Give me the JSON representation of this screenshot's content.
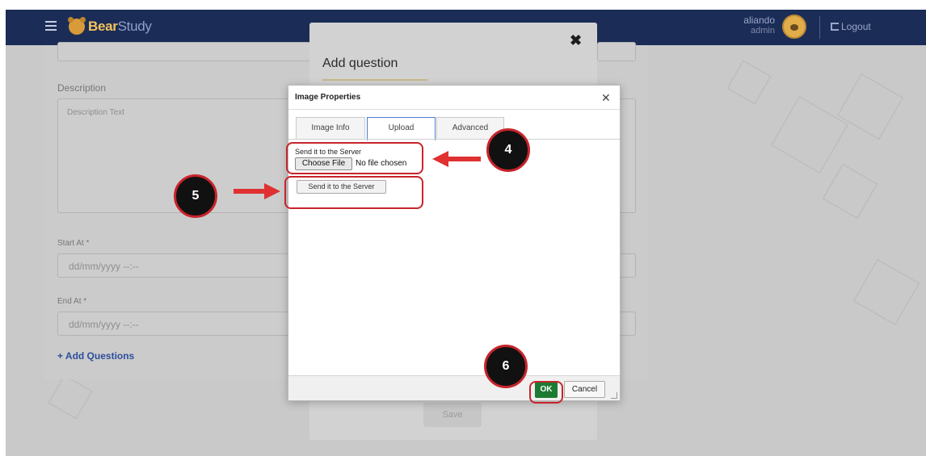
{
  "navbar": {
    "brand_part1": "Bear",
    "brand_part2": "Study",
    "user_name": "aliando",
    "user_role": "admin",
    "logout_label": "Logout"
  },
  "background_form": {
    "description_label": "Description",
    "description_placeholder": "Description Text",
    "start_label": "Start At *",
    "start_placeholder": "dd/mm/yyyy --:--",
    "end_label": "End At *",
    "end_placeholder": "dd/mm/yyyy --:--",
    "add_questions_label": "+ Add Questions"
  },
  "add_question_modal": {
    "title": "Add question",
    "close_glyph": "✖",
    "save_label": "Save"
  },
  "image_dialog": {
    "title": "Image Properties",
    "close_glyph": "✕",
    "tabs": [
      {
        "label": "Image Info"
      },
      {
        "label": "Upload"
      },
      {
        "label": "Advanced"
      }
    ],
    "active_tab": "Upload",
    "upload_label": "Send it to the Server",
    "choose_file_label": "Choose File",
    "no_file_text": "No file chosen",
    "send_button_label": "Send it to the Server",
    "ok_label": "OK",
    "cancel_label": "Cancel"
  },
  "annotations": {
    "badge_4": "4",
    "badge_5": "5",
    "badge_6": "6",
    "highlight_color": "#c8242b"
  },
  "colors": {
    "navbar_bg": "#1b2d57",
    "ok_green": "#1d7a32",
    "brand_gold": "#f5c35e"
  }
}
